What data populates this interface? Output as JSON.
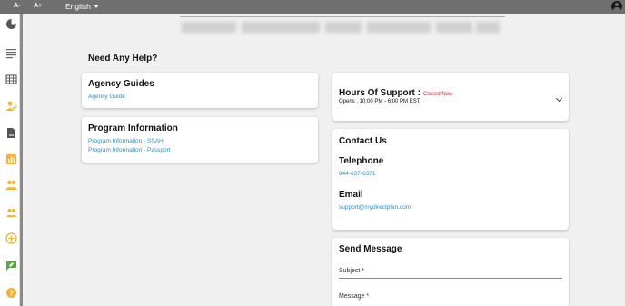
{
  "topbar": {
    "decrease_font": "A-",
    "increase_font": "A+",
    "language": "English"
  },
  "sidebar": {
    "icons": [
      "dashboard-pie-icon",
      "list-icon",
      "calendar-grid-icon",
      "person-check-icon",
      "document-icon",
      "bar-chart-icon",
      "people-icon",
      "group-icon",
      "add-circle-icon",
      "feedback-icon",
      "help-icon"
    ],
    "accent": "#f2b233"
  },
  "page": {
    "heading": "Need Any Help?"
  },
  "agency_guides": {
    "title": "Agency Guides",
    "links": [
      "Agency Guide"
    ]
  },
  "program_info": {
    "title": "Program Information",
    "links": [
      "Program Information - SSAH",
      "Program Information - Passport"
    ]
  },
  "hours": {
    "title": "Hours Of Support :",
    "status": "Closed Now",
    "opens": "Opens . 10:00 PM - 6:00 PM EST"
  },
  "contact": {
    "title": "Contact Us",
    "telephone_label": "Telephone",
    "telephone": "844-637-6371",
    "email_label": "Email",
    "email": "support@mydirectplan.com"
  },
  "send_message": {
    "title": "Send Message",
    "subject_label": "Subject *",
    "message_label": "Message *"
  },
  "colors": {
    "link": "#2a8fd0",
    "closed": "#d02a2a",
    "topbar": "#6f6f6f"
  }
}
